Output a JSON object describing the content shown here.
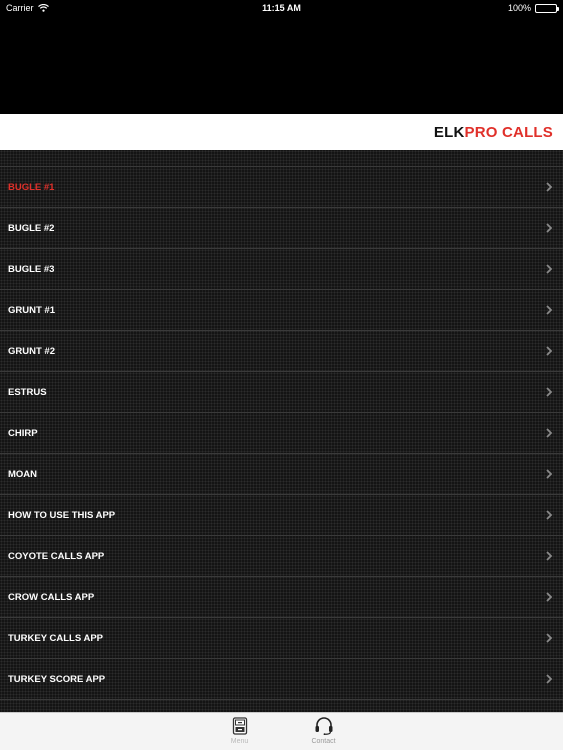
{
  "status_bar": {
    "carrier": "Carrier",
    "time": "11:15 AM",
    "battery": "100%"
  },
  "header": {
    "title_part1": "ELK",
    "title_part2": "PRO CALLS"
  },
  "menu": {
    "items": [
      {
        "label": "BUGLE #1"
      },
      {
        "label": "BUGLE #2"
      },
      {
        "label": "BUGLE #3"
      },
      {
        "label": "GRUNT #1"
      },
      {
        "label": "GRUNT #2"
      },
      {
        "label": "ESTRUS"
      },
      {
        "label": "CHIRP"
      },
      {
        "label": "MOAN"
      },
      {
        "label": "HOW TO USE THIS APP"
      },
      {
        "label": "COYOTE CALLS APP"
      },
      {
        "label": "CROW CALLS APP"
      },
      {
        "label": "TURKEY CALLS APP"
      },
      {
        "label": "TURKEY SCORE APP"
      }
    ]
  },
  "tabs": [
    {
      "label": "Menu"
    },
    {
      "label": "Contact"
    }
  ],
  "colors": {
    "accent": "#e0302a",
    "list_bg": "#141414",
    "tab_bg": "#f4f4f4"
  }
}
